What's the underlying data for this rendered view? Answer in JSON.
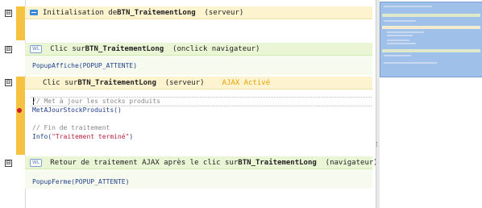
{
  "sections": [
    {
      "id": "init",
      "kind": "server",
      "title_prefix": "Initialisation de ",
      "control": "BTN_TraitementLong",
      "suffix": "(serveur)"
    },
    {
      "id": "clic-nav",
      "kind": "client",
      "badge": "WL",
      "title_prefix": "Clic sur ",
      "control": "BTN_TraitementLong",
      "suffix": "(onclick navigateur)",
      "code": [
        "PopupAffiche(POPUP_ATTENTE)"
      ]
    },
    {
      "id": "clic-srv",
      "kind": "server",
      "title_prefix": "Clic sur ",
      "control": "BTN_TraitementLong",
      "suffix": "(serveur)",
      "ajax": "AJAX Activé",
      "code": {
        "comment1": "// Met à jour les stocks produits",
        "call": "MetAJourStockProduits()",
        "comment2": "// Fin de traitement",
        "info_fn": "Info(",
        "info_str": "\"Traitement terminé\"",
        "info_end": ")"
      }
    },
    {
      "id": "retour",
      "kind": "client",
      "badge": "WL",
      "title_prefix": "Retour de traitement AJAX après le clic sur ",
      "control": "BTN_TraitementLong",
      "suffix": "(navigateur)",
      "code": [
        "PopupFerme(POPUP_ATTENTE)"
      ]
    }
  ],
  "gutter": {
    "collapse_symbol": "⊟"
  },
  "colors": {
    "server_bar": "#f5c242",
    "server_head": "#fdf3cf",
    "client_head": "#eaf5d6",
    "breakpoint": "#c8202a",
    "ajax": "#e8a000",
    "code": "#1e3f8a"
  }
}
